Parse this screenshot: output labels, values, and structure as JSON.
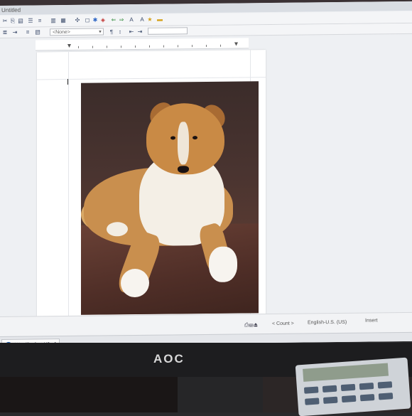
{
  "app": {
    "title_bar": "Untitled",
    "style_select_value": "<None>"
  },
  "toolbar": {
    "row1_icons": [
      "cut-icon",
      "copy-icon",
      "paste-icon",
      "undo-icon",
      "bullets-icon",
      "numbering-icon",
      "columns-icon",
      "table-icon",
      "symbols-icon",
      "insert-icon",
      "back-icon",
      "forward-icon",
      "text-color-icon",
      "highlight-icon",
      "star-icon",
      "chart-icon"
    ],
    "row2_icons": [
      "align-icon",
      "indent-icon",
      "justify-icon",
      "outline-icon"
    ]
  },
  "status_bar": {
    "count_label": "< Count >",
    "language": "English-U.S. (US)",
    "mode": "Insert"
  },
  "taskbar": {
    "app_button": "WordPerfect X9 - [..."
  },
  "monitor": {
    "brand": "AOC"
  },
  "colors": {
    "accent": "#1f5fb0",
    "page_background": "#ffffff",
    "workspace_background": "#eef0f3"
  }
}
